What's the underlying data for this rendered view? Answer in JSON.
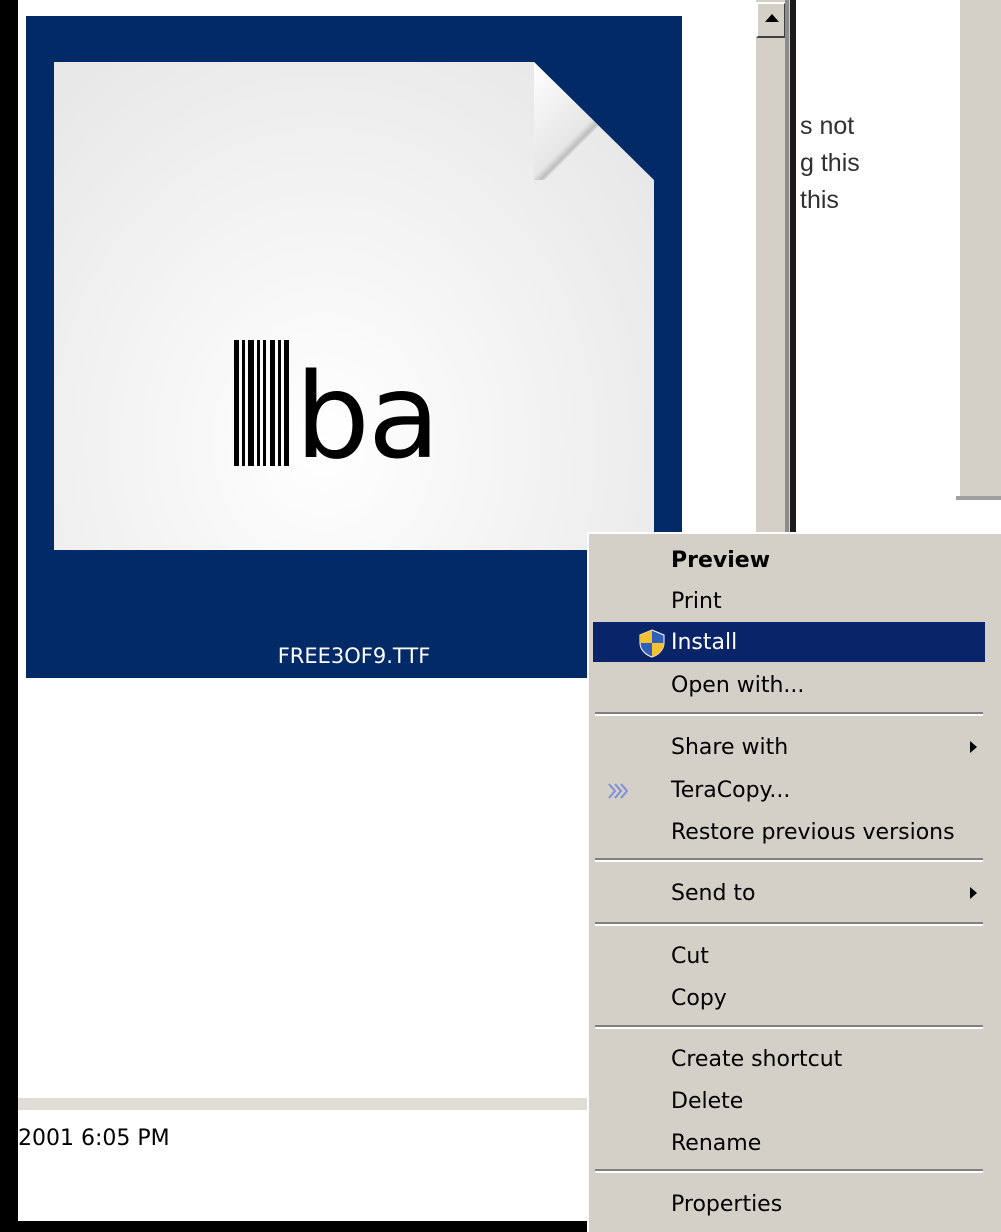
{
  "file": {
    "name": "FREE3OF9.TTF",
    "preview_text": "ba",
    "selection_color": "#022a66"
  },
  "side_text": [
    "s not",
    "g this",
    "this"
  ],
  "details": {
    "date_fragment": "2001 6:05 PM"
  },
  "context_menu": {
    "items": [
      {
        "label": "Preview",
        "bold": true
      },
      {
        "label": "Print"
      },
      {
        "label": "Install",
        "icon": "uac-shield-icon",
        "highlighted": true
      },
      {
        "label": "Open with..."
      },
      {
        "label": "Share with",
        "submenu": true
      },
      {
        "label": "TeraCopy...",
        "icon": "teracopy-icon"
      },
      {
        "label": "Restore previous versions"
      },
      {
        "label": "Send to",
        "submenu": true
      },
      {
        "label": "Cut"
      },
      {
        "label": "Copy"
      },
      {
        "label": "Create shortcut"
      },
      {
        "label": "Delete"
      },
      {
        "label": "Rename"
      },
      {
        "label": "Properties"
      }
    ],
    "highlight_color": "#0a246a"
  }
}
